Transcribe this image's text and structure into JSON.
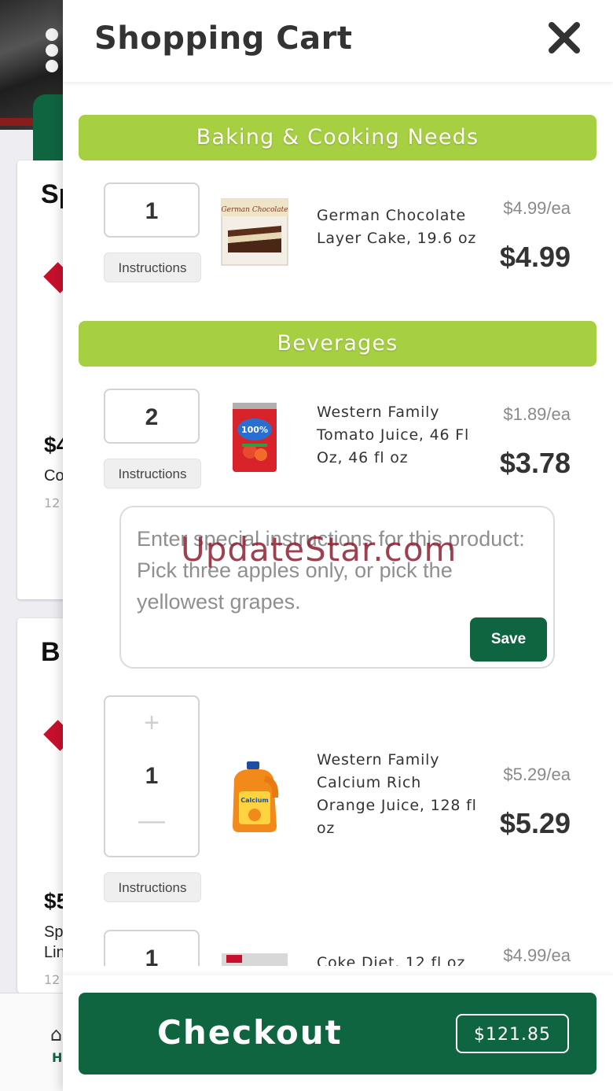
{
  "background": {
    "menu_dots": 3,
    "card1_heading": "Sp",
    "card1_price": "$4",
    "card1_sub": "Co",
    "card1_small": "12",
    "card2_heading": "B",
    "card2_price": "$5",
    "card2_sub1": "Sp",
    "card2_sub2": "Lin",
    "card2_small": "12",
    "nav_label": "H"
  },
  "cart": {
    "title": "Shopping Cart",
    "close_icon": "close-icon",
    "categories": [
      {
        "label": "Baking & Cooking Needs"
      },
      {
        "label": "Beverages"
      }
    ],
    "items": [
      {
        "qty": "1",
        "instructions_label": "Instructions",
        "name": "German Chocolate Layer Cake, 19.6 oz",
        "unit_price": "$4.99/ea",
        "total": "$4.99"
      },
      {
        "qty": "2",
        "instructions_label": "Instructions",
        "name": "Western Family Tomato Juice, 46 Fl Oz, 46 fl oz",
        "unit_price": "$1.89/ea",
        "total": "$3.78"
      },
      {
        "qty": "1",
        "instructions_label": "Instructions",
        "name": "Western Family Calcium Rich Orange Juice, 128 fl oz",
        "unit_price": "$5.29/ea",
        "total": "$5.29",
        "plus": "+",
        "minus": "—"
      },
      {
        "qty": "1",
        "name": "Coke Diet, 12 fl oz",
        "unit_price": "$4.99/ea"
      }
    ],
    "instructions_box": {
      "placeholder": "Enter special instructions for this product: Pick three apples only, or pick the yellowest grapes.",
      "save_label": "Save"
    },
    "watermark": "UpdateStar.com",
    "checkout": {
      "label": "Checkout",
      "total": "$121.85"
    }
  },
  "colors": {
    "accent_green": "#106541",
    "category_green": "#a7cf42"
  }
}
